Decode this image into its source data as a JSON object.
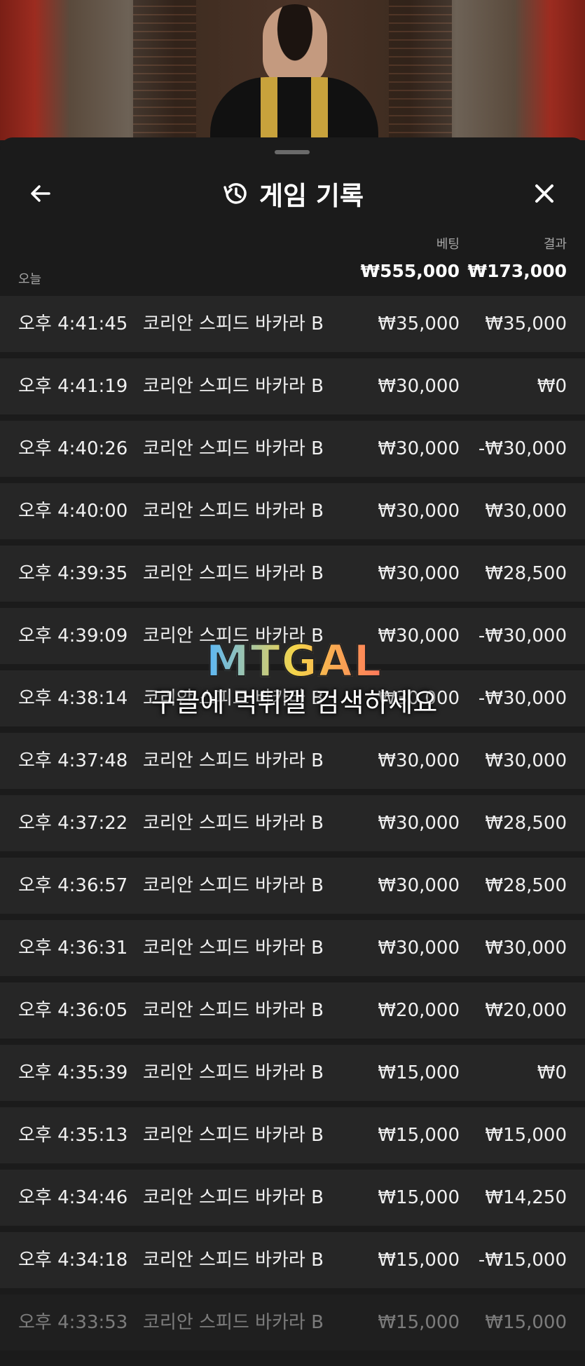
{
  "header": {
    "title": "게임 기록"
  },
  "columns": {
    "bet_label": "베팅",
    "result_label": "결과"
  },
  "summary": {
    "today_label": "오늘",
    "total_bet": "₩555,000",
    "total_result": "₩173,000"
  },
  "rows": [
    {
      "time": "오후 4:41:45",
      "game": "코리안 스피드 바카라 B",
      "bet": "₩35,000",
      "result": "₩35,000"
    },
    {
      "time": "오후 4:41:19",
      "game": "코리안 스피드 바카라 B",
      "bet": "₩30,000",
      "result": "₩0"
    },
    {
      "time": "오후 4:40:26",
      "game": "코리안 스피드 바카라 B",
      "bet": "₩30,000",
      "result": "-₩30,000"
    },
    {
      "time": "오후 4:40:00",
      "game": "코리안 스피드 바카라 B",
      "bet": "₩30,000",
      "result": "₩30,000"
    },
    {
      "time": "오후 4:39:35",
      "game": "코리안 스피드 바카라 B",
      "bet": "₩30,000",
      "result": "₩28,500"
    },
    {
      "time": "오후 4:39:09",
      "game": "코리안 스피드 바카라 B",
      "bet": "₩30,000",
      "result": "-₩30,000"
    },
    {
      "time": "오후 4:38:14",
      "game": "코리안 스피드 바카라 B",
      "bet": "₩30,000",
      "result": "-₩30,000"
    },
    {
      "time": "오후 4:37:48",
      "game": "코리안 스피드 바카라 B",
      "bet": "₩30,000",
      "result": "₩30,000"
    },
    {
      "time": "오후 4:37:22",
      "game": "코리안 스피드 바카라 B",
      "bet": "₩30,000",
      "result": "₩28,500"
    },
    {
      "time": "오후 4:36:57",
      "game": "코리안 스피드 바카라 B",
      "bet": "₩30,000",
      "result": "₩28,500"
    },
    {
      "time": "오후 4:36:31",
      "game": "코리안 스피드 바카라 B",
      "bet": "₩30,000",
      "result": "₩30,000"
    },
    {
      "time": "오후 4:36:05",
      "game": "코리안 스피드 바카라 B",
      "bet": "₩20,000",
      "result": "₩20,000"
    },
    {
      "time": "오후 4:35:39",
      "game": "코리안 스피드 바카라 B",
      "bet": "₩15,000",
      "result": "₩0"
    },
    {
      "time": "오후 4:35:13",
      "game": "코리안 스피드 바카라 B",
      "bet": "₩15,000",
      "result": "₩15,000"
    },
    {
      "time": "오후 4:34:46",
      "game": "코리안 스피드 바카라 B",
      "bet": "₩15,000",
      "result": "₩14,250"
    },
    {
      "time": "오후 4:34:18",
      "game": "코리안 스피드 바카라 B",
      "bet": "₩15,000",
      "result": "-₩15,000"
    },
    {
      "time": "오후 4:33:53",
      "game": "코리안 스피드 바카라 B",
      "bet": "₩15,000",
      "result": "₩15,000"
    }
  ],
  "watermark": {
    "logo": "MTGAL",
    "text": "구글에 먹튀갤 검색하세요"
  },
  "icons": {
    "back": "arrow-left-icon",
    "history": "history-icon",
    "close": "close-icon"
  }
}
